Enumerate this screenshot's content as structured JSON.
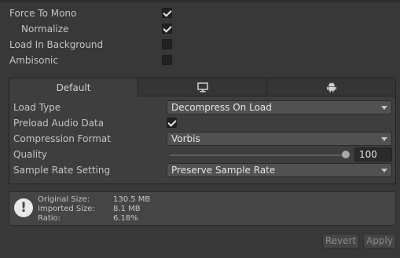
{
  "settings": {
    "force_to_mono": {
      "label": "Force To Mono",
      "checked": true
    },
    "normalize": {
      "label": "Normalize",
      "checked": true
    },
    "load_in_background": {
      "label": "Load In Background",
      "checked": false
    },
    "ambisonic": {
      "label": "Ambisonic",
      "checked": false
    }
  },
  "platform_tabs": [
    {
      "label": "Default",
      "icon": "",
      "active": true
    },
    {
      "label": "",
      "icon": "monitor-icon",
      "active": false
    },
    {
      "label": "",
      "icon": "android-icon",
      "active": false
    }
  ],
  "platform": {
    "load_type": {
      "label": "Load Type",
      "value": "Decompress On Load"
    },
    "preload_audio_data": {
      "label": "Preload Audio Data",
      "checked": true
    },
    "compression_format": {
      "label": "Compression Format",
      "value": "Vorbis"
    },
    "quality": {
      "label": "Quality",
      "value": "100",
      "fraction": 1.0
    },
    "sample_rate_setting": {
      "label": "Sample Rate Setting",
      "value": "Preserve Sample Rate"
    }
  },
  "info": {
    "icon": "info-icon",
    "original_size_label": "Original Size:",
    "original_size": "130.5 MB",
    "imported_size_label": "Imported Size:",
    "imported_size": "8.1 MB",
    "ratio_label": "Ratio:",
    "ratio": "6.18%"
  },
  "actions": {
    "revert_label": "Revert",
    "apply_label": "Apply"
  }
}
